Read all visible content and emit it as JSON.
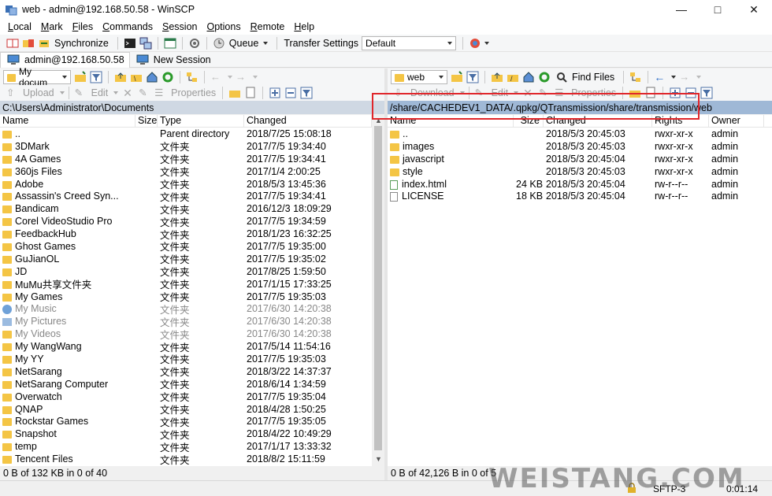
{
  "window": {
    "title": "web - admin@192.168.50.58 - WinSCP"
  },
  "menu": [
    {
      "u": "L",
      "rest": "ocal"
    },
    {
      "u": "M",
      "rest": "ark"
    },
    {
      "u": "F",
      "rest": "iles"
    },
    {
      "u": "C",
      "rest": "ommands"
    },
    {
      "u": "S",
      "rest": "ession"
    },
    {
      "u": "O",
      "rest": "ptions"
    },
    {
      "u": "R",
      "rest": "emote"
    },
    {
      "u": "H",
      "rest": "elp"
    }
  ],
  "toolbar": {
    "synchronize": "Synchronize",
    "queue": "Queue",
    "transfer_settings_label": "Transfer Settings",
    "transfer_settings_value": "Default"
  },
  "sessions": {
    "current": "admin@192.168.50.58",
    "new": "New Session"
  },
  "left": {
    "location": "My docum",
    "upload": "Upload",
    "edit": "Edit",
    "properties": "Properties",
    "path": "C:\\Users\\Administrator\\Documents",
    "headers": [
      "Name",
      "Size",
      "Type",
      "Changed"
    ],
    "rows": [
      {
        "name": "..",
        "size": "",
        "type": "Parent directory",
        "changed": "2018/7/25  15:08:18",
        "icon": "up",
        "dim": false
      },
      {
        "name": "3DMark",
        "size": "",
        "type": "文件夹",
        "changed": "2017/7/5  19:34:40",
        "icon": "folder",
        "dim": false
      },
      {
        "name": "4A Games",
        "size": "",
        "type": "文件夹",
        "changed": "2017/7/5  19:34:41",
        "icon": "folder",
        "dim": false
      },
      {
        "name": "360js Files",
        "size": "",
        "type": "文件夹",
        "changed": "2017/1/4  2:00:25",
        "icon": "folder",
        "dim": false
      },
      {
        "name": "Adobe",
        "size": "",
        "type": "文件夹",
        "changed": "2018/5/3  13:45:36",
        "icon": "folder",
        "dim": false
      },
      {
        "name": "Assassin's Creed Syn...",
        "size": "",
        "type": "文件夹",
        "changed": "2017/7/5  19:34:41",
        "icon": "folder",
        "dim": false
      },
      {
        "name": "Bandicam",
        "size": "",
        "type": "文件夹",
        "changed": "2016/12/3  18:09:29",
        "icon": "folder",
        "dim": false
      },
      {
        "name": "Corel VideoStudio Pro",
        "size": "",
        "type": "文件夹",
        "changed": "2017/7/5  19:34:59",
        "icon": "folder",
        "dim": false
      },
      {
        "name": "FeedbackHub",
        "size": "",
        "type": "文件夹",
        "changed": "2018/1/23  16:32:25",
        "icon": "folder",
        "dim": false
      },
      {
        "name": "Ghost Games",
        "size": "",
        "type": "文件夹",
        "changed": "2017/7/5  19:35:00",
        "icon": "folder",
        "dim": false
      },
      {
        "name": "GuJianOL",
        "size": "",
        "type": "文件夹",
        "changed": "2017/7/5  19:35:02",
        "icon": "folder",
        "dim": false
      },
      {
        "name": "JD",
        "size": "",
        "type": "文件夹",
        "changed": "2017/8/25  1:59:50",
        "icon": "folder",
        "dim": false
      },
      {
        "name": "MuMu共享文件夹",
        "size": "",
        "type": "文件夹",
        "changed": "2017/1/15  17:33:25",
        "icon": "folder",
        "dim": false
      },
      {
        "name": "My Games",
        "size": "",
        "type": "文件夹",
        "changed": "2017/7/5  19:35:03",
        "icon": "folder",
        "dim": false
      },
      {
        "name": "My Music",
        "size": "",
        "type": "文件夹",
        "changed": "2017/6/30  14:20:38",
        "icon": "music",
        "dim": true
      },
      {
        "name": "My Pictures",
        "size": "",
        "type": "文件夹",
        "changed": "2017/6/30  14:20:38",
        "icon": "pic",
        "dim": true
      },
      {
        "name": "My Videos",
        "size": "",
        "type": "文件夹",
        "changed": "2017/6/30  14:20:38",
        "icon": "folder",
        "dim": true
      },
      {
        "name": "My WangWang",
        "size": "",
        "type": "文件夹",
        "changed": "2017/5/14  11:54:16",
        "icon": "folder",
        "dim": false
      },
      {
        "name": "My YY",
        "size": "",
        "type": "文件夹",
        "changed": "2017/7/5  19:35:03",
        "icon": "folder",
        "dim": false
      },
      {
        "name": "NetSarang",
        "size": "",
        "type": "文件夹",
        "changed": "2018/3/22  14:37:37",
        "icon": "folder",
        "dim": false
      },
      {
        "name": "NetSarang Computer",
        "size": "",
        "type": "文件夹",
        "changed": "2018/6/14  1:34:59",
        "icon": "folder",
        "dim": false
      },
      {
        "name": "Overwatch",
        "size": "",
        "type": "文件夹",
        "changed": "2017/7/5  19:35:04",
        "icon": "folder",
        "dim": false
      },
      {
        "name": "QNAP",
        "size": "",
        "type": "文件夹",
        "changed": "2018/4/28  1:50:25",
        "icon": "folder",
        "dim": false
      },
      {
        "name": "Rockstar Games",
        "size": "",
        "type": "文件夹",
        "changed": "2017/7/5  19:35:05",
        "icon": "folder",
        "dim": false
      },
      {
        "name": "Snapshot",
        "size": "",
        "type": "文件夹",
        "changed": "2018/4/22  10:49:29",
        "icon": "folder",
        "dim": false
      },
      {
        "name": "temp",
        "size": "",
        "type": "文件夹",
        "changed": "2017/1/17  13:33:32",
        "icon": "folder",
        "dim": false
      },
      {
        "name": "Tencent Files",
        "size": "",
        "type": "文件夹",
        "changed": "2018/8/2  15:11:59",
        "icon": "folder",
        "dim": false
      }
    ],
    "status": "0 B of 132 KB in 0 of 40"
  },
  "right": {
    "location": "web",
    "find_files": "Find Files",
    "download": "Download",
    "edit": "Edit",
    "properties": "Properties",
    "path": "/share/CACHEDEV1_DATA/.qpkg/QTransmission/share/transmission/web",
    "headers": [
      "Name",
      "Size",
      "Changed",
      "Rights",
      "Owner"
    ],
    "rows": [
      {
        "name": "..",
        "size": "",
        "changed": "2018/5/3  20:45:03",
        "rights": "rwxr-xr-x",
        "owner": "admin",
        "icon": "up"
      },
      {
        "name": "images",
        "size": "",
        "changed": "2018/5/3  20:45:03",
        "rights": "rwxr-xr-x",
        "owner": "admin",
        "icon": "folder"
      },
      {
        "name": "javascript",
        "size": "",
        "changed": "2018/5/3  20:45:04",
        "rights": "rwxr-xr-x",
        "owner": "admin",
        "icon": "folder"
      },
      {
        "name": "style",
        "size": "",
        "changed": "2018/5/3  20:45:03",
        "rights": "rwxr-xr-x",
        "owner": "admin",
        "icon": "folder"
      },
      {
        "name": "index.html",
        "size": "24 KB",
        "changed": "2018/5/3  20:45:04",
        "rights": "rw-r--r--",
        "owner": "admin",
        "icon": "html"
      },
      {
        "name": "LICENSE",
        "size": "18 KB",
        "changed": "2018/5/3  20:45:04",
        "rights": "rw-r--r--",
        "owner": "admin",
        "icon": "file"
      }
    ],
    "status": "0 B of 42,126 B in 0 of 5"
  },
  "bottom": {
    "protocol": "SFTP-3",
    "elapsed": "0:01:14"
  },
  "watermark": "WEISTANG.COM",
  "colors": {
    "highlight": "#e0262b",
    "right_path_bg": "#9fb8d6",
    "left_path_bg": "#cfd8e3"
  }
}
